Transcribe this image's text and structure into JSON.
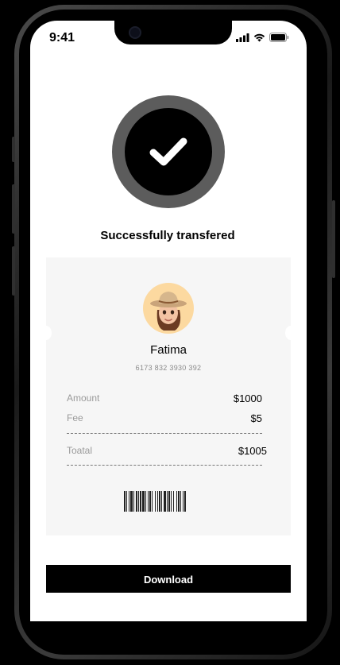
{
  "status_bar": {
    "time": "9:41"
  },
  "icons": {
    "signal": "signal-icon",
    "wifi": "wifi-icon",
    "battery": "battery-icon",
    "check": "checkmark-icon"
  },
  "title": "Successfully transfered",
  "recipient": {
    "name": "Fatima",
    "account_number": "6173 832 3930 392"
  },
  "details": {
    "amount_label": "Amount",
    "amount_value": "$1000",
    "fee_label": "Fee",
    "fee_value": "$5",
    "total_label": "Toatal",
    "total_value": "$1005"
  },
  "download_label": "Download",
  "colors": {
    "accent": "#000000",
    "ring": "#5c5c5c",
    "card_bg": "#f6f6f6",
    "avatar_bg": "#fcd9a0"
  }
}
